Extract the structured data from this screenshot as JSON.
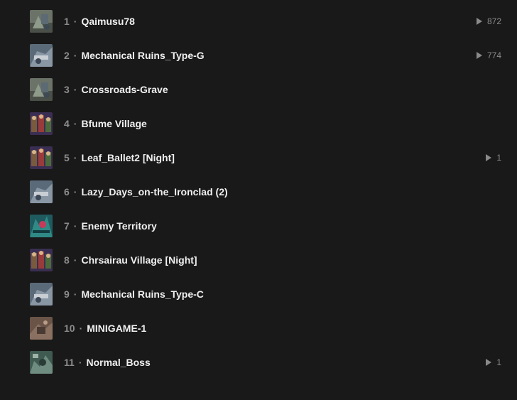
{
  "tracks": [
    {
      "number": "1",
      "title": "Qaimusu78",
      "plays": "872",
      "thumb": "thumb-gray"
    },
    {
      "number": "2",
      "title": "Mechanical Ruins_Type-G",
      "plays": "774",
      "thumb": "thumb-blue"
    },
    {
      "number": "3",
      "title": "Crossroads-Grave",
      "plays": "",
      "thumb": "thumb-gray"
    },
    {
      "number": "4",
      "title": "Bfume Village",
      "plays": "",
      "thumb": "thumb-purple"
    },
    {
      "number": "5",
      "title": "Leaf_Ballet2 [Night]",
      "plays": "1",
      "thumb": "thumb-purple"
    },
    {
      "number": "6",
      "title": "Lazy_Days_on-the_Ironclad (2)",
      "plays": "",
      "thumb": "thumb-blue"
    },
    {
      "number": "7",
      "title": "Enemy Territory",
      "plays": "",
      "thumb": "thumb-teal"
    },
    {
      "number": "8",
      "title": "Chrsairau Village [Night]",
      "plays": "",
      "thumb": "thumb-purple"
    },
    {
      "number": "9",
      "title": "Mechanical Ruins_Type-C",
      "plays": "",
      "thumb": "thumb-blue"
    },
    {
      "number": "10",
      "title": "MINIGAME-1",
      "plays": "",
      "thumb": "thumb-brown"
    },
    {
      "number": "11",
      "title": "Normal_Boss",
      "plays": "1",
      "thumb": "thumb-green"
    }
  ],
  "separator": "·",
  "colors": {
    "background": "#191919",
    "title": "#f0f0f0",
    "muted": "#8b8b8b"
  }
}
